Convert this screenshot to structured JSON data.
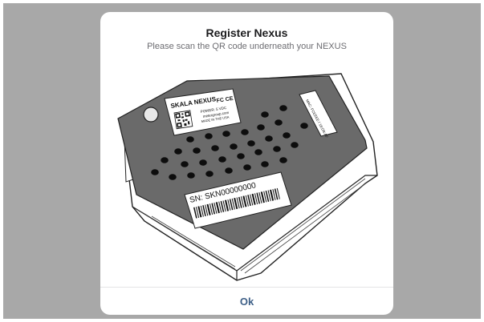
{
  "dialog": {
    "title": "Register Nexus",
    "subtitle": "Please scan the QR code underneath your NEXUS",
    "ok_label": "Ok"
  },
  "device": {
    "brand_label": "SKALA NEXUS",
    "cert_label": "FC CE",
    "power_label": "POWER: 5 VDC",
    "website_label": "metergroup.com",
    "origin_label": "MADE IN THE USA",
    "serial_label": "SN: SKN00000000",
    "mac_label": "MAC: FCEEEE / 18:DB:AF"
  },
  "colors": {
    "backdrop": "#a8a8a8",
    "accent": "#3d5f87",
    "device_body": "#ffffff",
    "device_top": "#6a6a6a"
  }
}
